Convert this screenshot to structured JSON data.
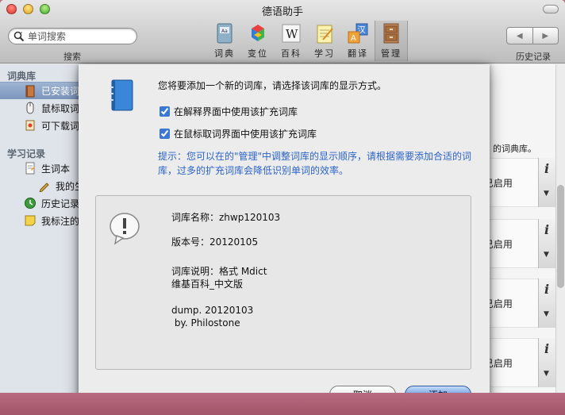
{
  "window": {
    "title": "德语助手"
  },
  "search": {
    "placeholder": "单词搜索",
    "caption": "搜索"
  },
  "toolbar": {
    "items": [
      {
        "label": "词典",
        "icon": "dictionary-icon"
      },
      {
        "label": "变位",
        "icon": "conjugation-icon"
      },
      {
        "label": "百科",
        "icon": "wikipedia-icon"
      },
      {
        "label": "学习",
        "icon": "study-notepad-icon"
      },
      {
        "label": "翻译",
        "icon": "translate-icon"
      },
      {
        "label": "管理",
        "icon": "manage-cabinet-icon"
      }
    ],
    "active": "管理"
  },
  "history": {
    "caption": "历史记录",
    "back": "◀",
    "forward": "▶"
  },
  "sidebar": {
    "section1": "词典库",
    "items1": [
      "已安装词",
      "鼠标取词",
      "可下载词"
    ],
    "section2": "学习记录",
    "items2": [
      "生词本",
      "我的生",
      "历史记录",
      "我标注的"
    ]
  },
  "content": {
    "partial_text": "的词典库。",
    "status_label": "已启用",
    "status_check": "✓",
    "info_glyph": "i",
    "expand_glyph": "▼"
  },
  "dialog": {
    "title": "您将要添加一个新的词库，请选择该词库的显示方式。",
    "option1": {
      "label": "在解释界面中使用该扩充词库",
      "checked": true
    },
    "option2": {
      "label": "在鼠标取词界面中使用该扩充词库",
      "checked": true
    },
    "hint": "提示：您可以在的\"管理\"中调整词库的显示顺序，请根据需要添加合适的词库，过多的扩充词库会降低识别单词的效率。",
    "info": {
      "name": "词库名称：zhwp120103",
      "version": "版本号：20120105",
      "desc1": "词库说明：格式 Mdict",
      "desc2": "维基百科_中文版",
      "dump": "dump. 20120103",
      "by": " by. Philostone"
    },
    "cancel_label": "取消",
    "add_label": "添加"
  },
  "colors": {
    "accent": "#2d64c8",
    "selection": "#7b95bc"
  }
}
